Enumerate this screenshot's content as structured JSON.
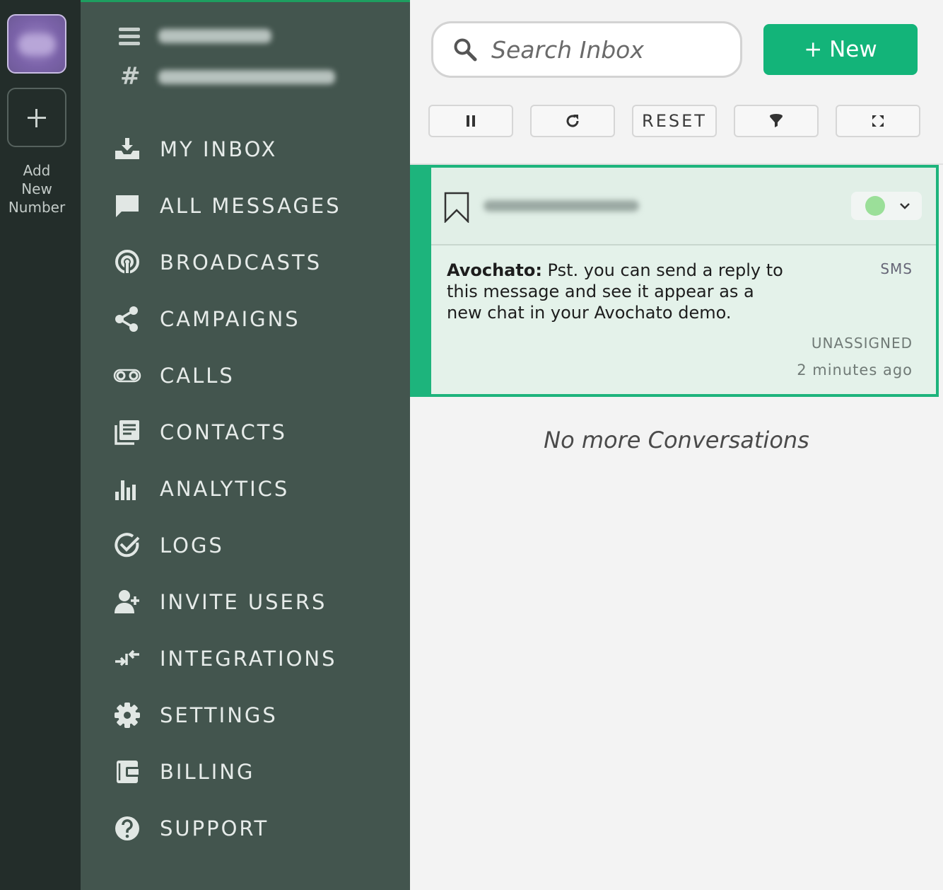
{
  "sidebar": {
    "add_number_label": "Add\nNew\nNumber",
    "header_hash": "#",
    "items": [
      {
        "label": "MY INBOX",
        "icon": "inbox-icon"
      },
      {
        "label": "ALL MESSAGES",
        "icon": "chat-bubble-icon"
      },
      {
        "label": "BROADCASTS",
        "icon": "broadcast-icon"
      },
      {
        "label": "CAMPAIGNS",
        "icon": "share-icon"
      },
      {
        "label": "CALLS",
        "icon": "voicemail-icon"
      },
      {
        "label": "CONTACTS",
        "icon": "contacts-icon"
      },
      {
        "label": "ANALYTICS",
        "icon": "bar-chart-icon"
      },
      {
        "label": "LOGS",
        "icon": "check-circle-icon"
      },
      {
        "label": "INVITE USERS",
        "icon": "add-user-icon"
      },
      {
        "label": "INTEGRATIONS",
        "icon": "integrations-icon"
      },
      {
        "label": "SETTINGS",
        "icon": "gear-icon"
      },
      {
        "label": "BILLING",
        "icon": "wallet-icon"
      },
      {
        "label": "SUPPORT",
        "icon": "help-icon"
      }
    ]
  },
  "search": {
    "placeholder": "Search Inbox"
  },
  "toolbar": {
    "new_label": "+ New",
    "reset_label": "RESET",
    "buttons": [
      "pause-icon",
      "refresh-icon",
      "filter-icon",
      "expand-icon"
    ]
  },
  "conversation": {
    "sender": "Avochato:",
    "message": " Pst. you can send a reply to this message and see it appear as a new chat in your Avochato demo.",
    "channel": "SMS",
    "assignee": "UNASSIGNED",
    "time_ago": "2 minutes ago",
    "status_color": "#9bdf99"
  },
  "empty_state": "No more Conversations",
  "colors": {
    "accent": "#13b479",
    "rail_bg": "#232d2a",
    "nav_bg": "#43554e"
  }
}
